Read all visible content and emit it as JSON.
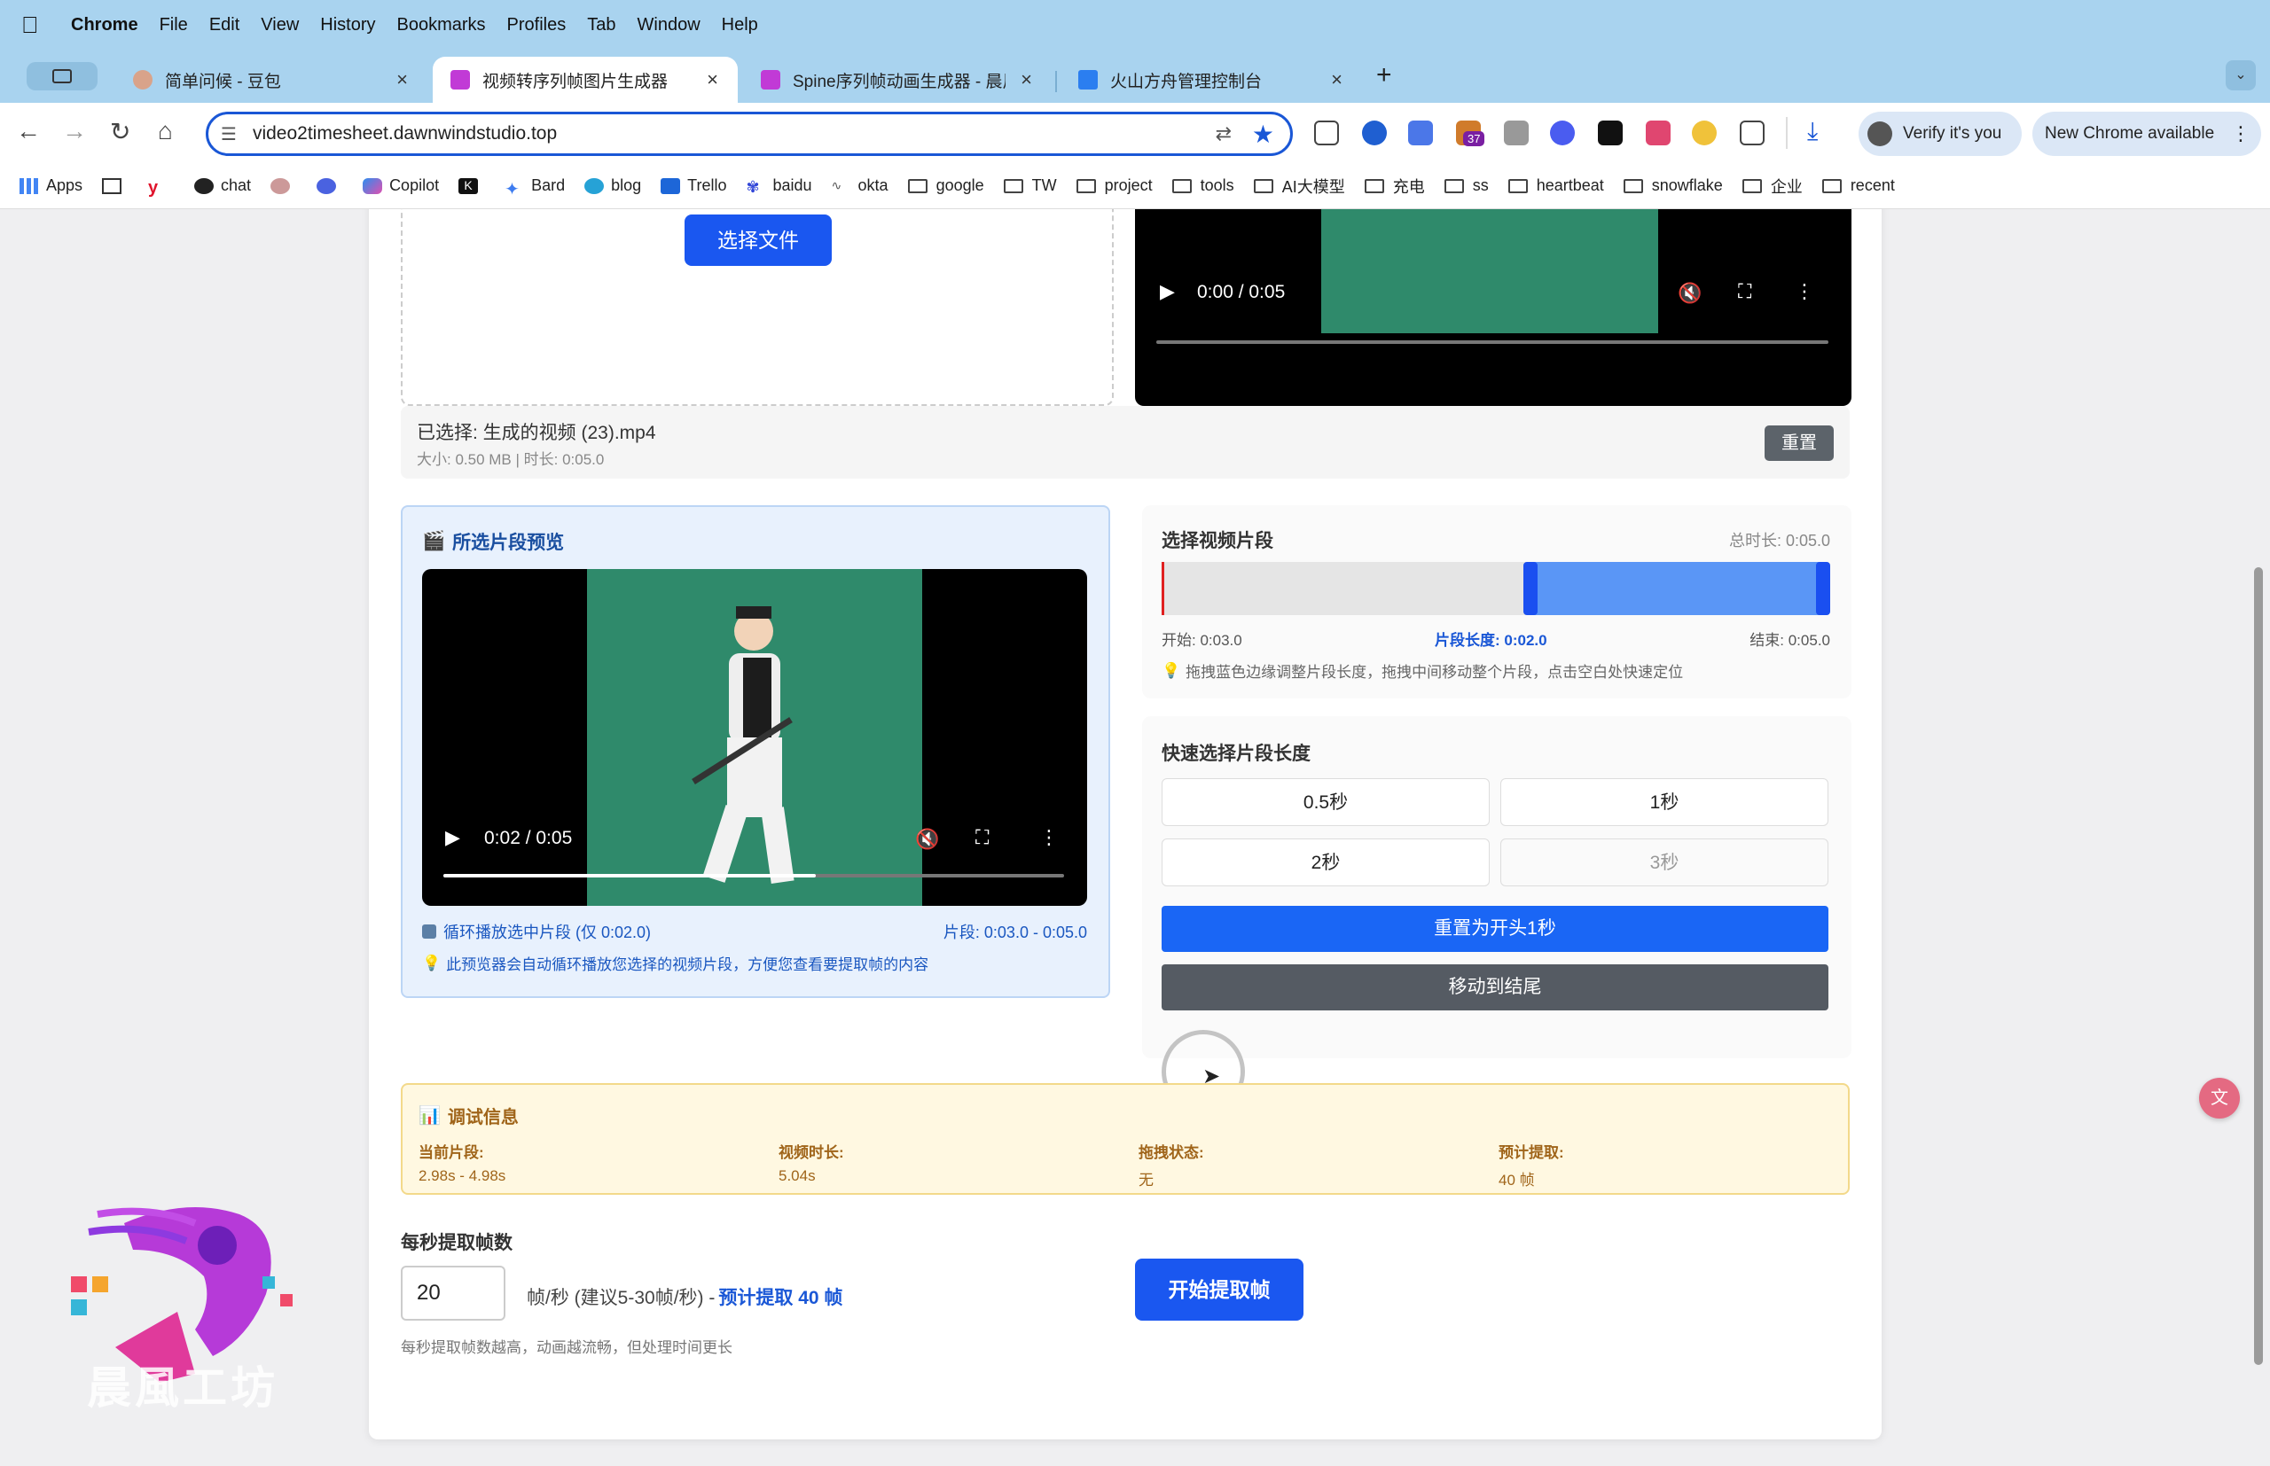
{
  "menubar": {
    "app": "Chrome",
    "items": [
      "File",
      "Edit",
      "View",
      "History",
      "Bookmarks",
      "Profiles",
      "Tab",
      "Window",
      "Help"
    ]
  },
  "tabs": [
    {
      "title": "简单问候 - 豆包",
      "active": false
    },
    {
      "title": "视频转序列帧图片生成器",
      "active": true
    },
    {
      "title": "Spine序列帧动画生成器 - 晨风工坊",
      "active": false
    },
    {
      "title": "火山方舟管理控制台",
      "active": false
    }
  ],
  "toolbar": {
    "url": "video2timesheet.dawnwindstudio.top",
    "verify_label": "Verify it's you",
    "new_chrome_label": "New Chrome available",
    "ext_badge": "37"
  },
  "bookmarks": [
    {
      "label": "Apps",
      "icon": "apps-grid-icon"
    },
    {
      "label": "chat",
      "icon": "openai-icon"
    },
    {
      "label": "Copilot",
      "icon": "copilot-icon"
    },
    {
      "label": "Bard",
      "icon": "bard-icon"
    },
    {
      "label": "blog",
      "icon": "blog-icon"
    },
    {
      "label": "Trello",
      "icon": "trello-icon"
    },
    {
      "label": "baidu",
      "icon": "baidu-icon"
    },
    {
      "label": "okta",
      "icon": "okta-icon"
    },
    {
      "label": "google",
      "icon": "folder-icon"
    },
    {
      "label": "TW",
      "icon": "folder-icon"
    },
    {
      "label": "project",
      "icon": "folder-icon"
    },
    {
      "label": "tools",
      "icon": "folder-icon"
    },
    {
      "label": "AI大模型",
      "icon": "folder-icon"
    },
    {
      "label": "充电",
      "icon": "folder-icon"
    },
    {
      "label": "ss",
      "icon": "folder-icon"
    },
    {
      "label": "heartbeat",
      "icon": "folder-icon"
    },
    {
      "label": "snowflake",
      "icon": "folder-icon"
    },
    {
      "label": "企业",
      "icon": "folder-icon"
    },
    {
      "label": "recent",
      "icon": "folder-icon"
    }
  ],
  "upload": {
    "choose_button": "选择文件",
    "top_video_time": "0:00 / 0:05"
  },
  "file_info": {
    "selected": "已选择: 生成的视频 (23).mp4",
    "meta": "大小: 0.50 MB | 时长: 0:05.0",
    "reset_button": "重置"
  },
  "preview": {
    "title": "所选片段预览",
    "time": "0:02 / 0:05",
    "loop_label": "循环播放选中片段 (仅 0:02.0)",
    "segment_label": "片段: 0:03.0 - 0:05.0",
    "hint": "此预览器会自动循环播放您选择的视频片段，方便您查看要提取帧的内容",
    "progress": 0.6
  },
  "segment": {
    "title": "选择视频片段",
    "total": "总时长: 0:05.0",
    "start_label": "开始: 0:03.0",
    "length_label": "片段长度: 0:02.0",
    "end_label": "结束: 0:05.0",
    "hint": "拖拽蓝色边缘调整片段长度，拖拽中间移动整个片段，点击空白处快速定位",
    "start_fraction": 0.6,
    "end_fraction": 1.0
  },
  "quick": {
    "title": "快速选择片段长度",
    "options": [
      "0.5秒",
      "1秒",
      "2秒",
      "3秒"
    ],
    "reset_first": "重置为开头1秒",
    "move_end": "移动到结尾"
  },
  "debug": {
    "title": "调试信息",
    "items": [
      {
        "label": "当前片段:",
        "value": "2.98s - 4.98s"
      },
      {
        "label": "视频时长:",
        "value": "5.04s"
      },
      {
        "label": "拖拽状态:",
        "value": "无"
      },
      {
        "label": "预计提取:",
        "value": "40 帧"
      }
    ]
  },
  "fps": {
    "title": "每秒提取帧数",
    "value": "20",
    "unit_text": "帧/秒 (建议5-30帧/秒) -",
    "estimate": "预计提取 40 帧",
    "hint": "每秒提取帧数越高，动画越流畅，但处理时间更长",
    "start_button": "开始提取帧"
  },
  "logo_text": "晨風工坊",
  "colors": {
    "accent": "#1a57f0",
    "dark_button": "#555b63",
    "debug_bg": "#fff8e1",
    "preview_bg": "#e8f1fd"
  }
}
